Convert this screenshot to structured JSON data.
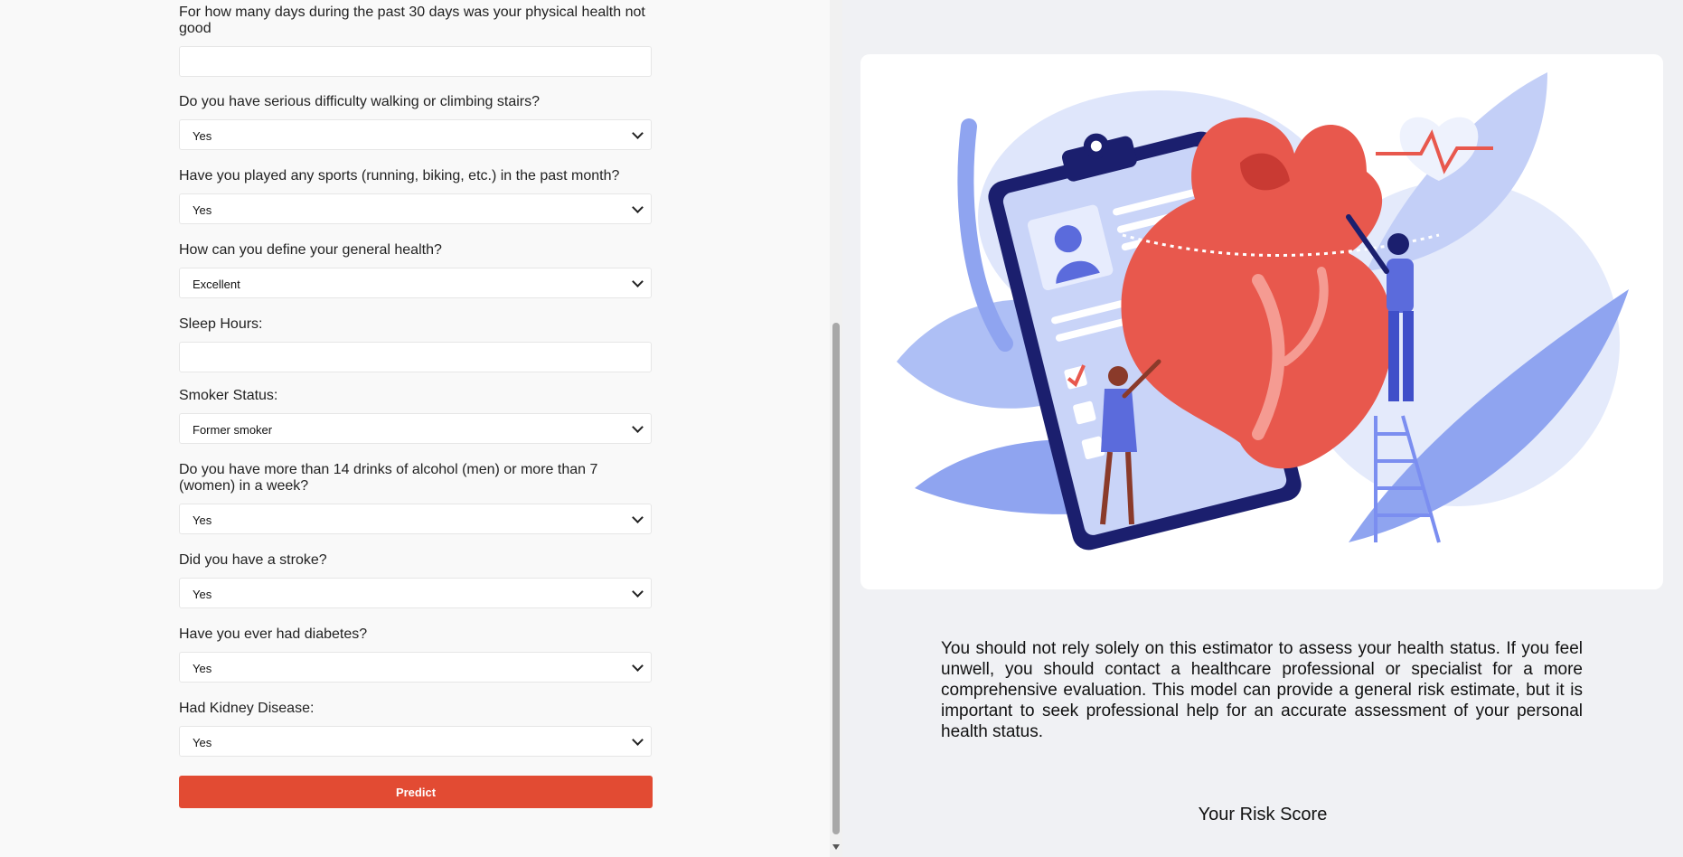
{
  "form": {
    "q_physical_days": "For how many days during the past 30 days was your physical health not good",
    "physical_days_value": "",
    "q_difficulty_walking": "Do you have serious difficulty walking or climbing stairs?",
    "difficulty_walking_value": "Yes",
    "q_sports": "Have you played any sports (running, biking, etc.) in the past month?",
    "sports_value": "Yes",
    "q_general_health": "How can you define your general health?",
    "general_health_value": "Excellent",
    "q_sleep_hours": "Sleep Hours:",
    "sleep_hours_value": "",
    "q_smoker": "Smoker Status:",
    "smoker_value": "Former smoker",
    "q_alcohol": "Do you have more than 14 drinks of alcohol (men) or more than 7 (women) in a week?",
    "alcohol_value": "Yes",
    "q_stroke": "Did you have a stroke?",
    "stroke_value": "Yes",
    "q_diabetes": "Have you ever had diabetes?",
    "diabetes_value": "Yes",
    "q_kidney": "Had Kidney Disease:",
    "kidney_value": "Yes",
    "predict_label": "Predict"
  },
  "right": {
    "disclaimer": "You should not rely solely on this estimator to assess your health status. If you feel unwell, you should contact a healthcare professional or specialist for a more comprehensive evaluation. This model can provide a general risk estimate, but it is important to seek professional help for an accurate assessment of your personal health status.",
    "risk_title": "Your Risk Score",
    "illustration": "heart-health-illustration"
  },
  "colors": {
    "accent": "#e24b33",
    "heart": "#e8584d",
    "blue": "#5b6bdc",
    "light_blue": "#aebff5"
  }
}
